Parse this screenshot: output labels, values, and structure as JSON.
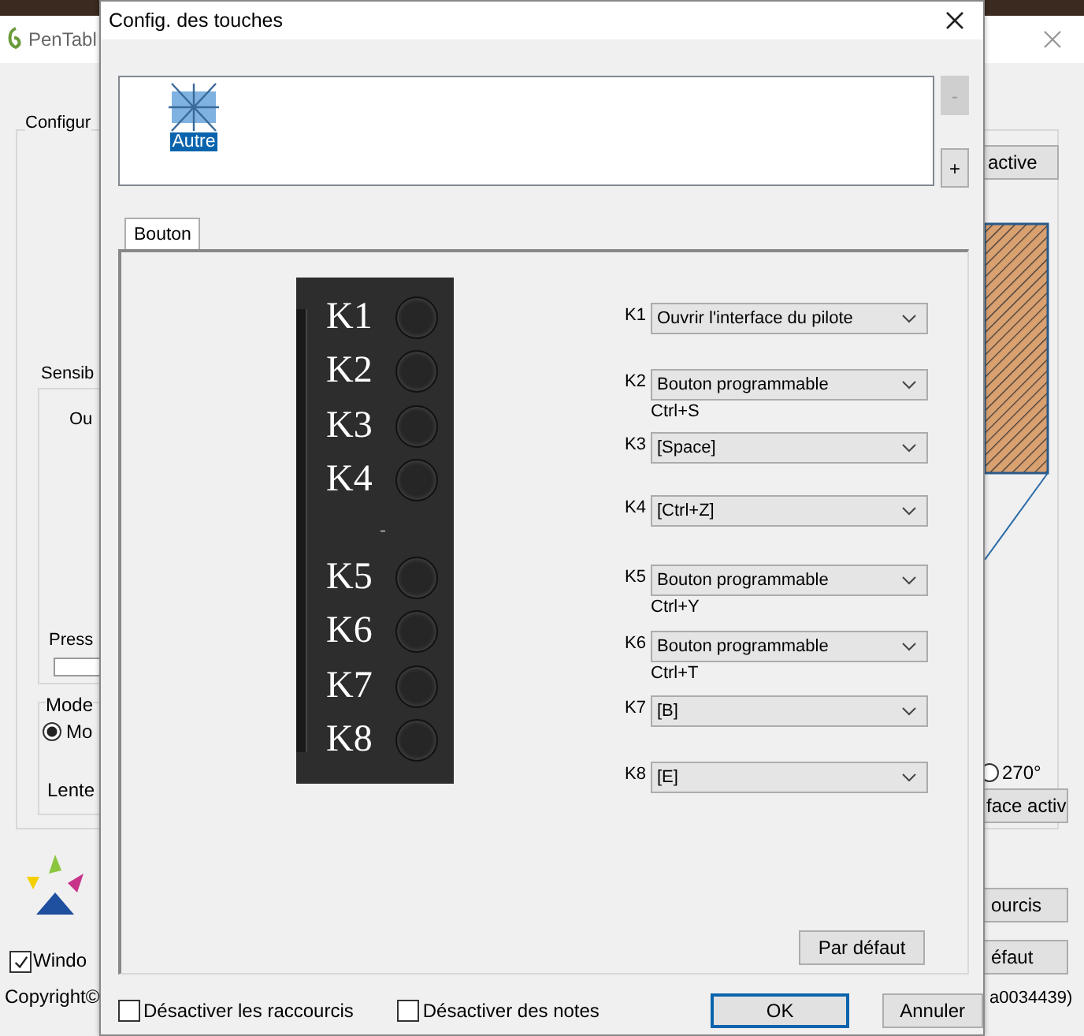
{
  "background_window": {
    "title": "PenTabl",
    "group_title": "Configur",
    "sensitivity_title": "Sensib",
    "output_label": "Ou",
    "pressure_label": "Press",
    "mode_title": "Mode",
    "mode_option": {
      "label": "Mo",
      "selected": true
    },
    "speed_label": "Lente",
    "windows_checkbox": {
      "label": "Windo",
      "checked": true
    },
    "copyright": "Copyright©",
    "active_button": "active",
    "rotation_option": {
      "label": "270°",
      "selected": false
    },
    "interface_button": "face activ",
    "shortcuts_button": "ourcis",
    "default_button": "éfaut",
    "version": "a0034439)"
  },
  "dialog": {
    "title": "Config. des touches",
    "app_list": [
      {
        "label": "Autre",
        "selected": true
      }
    ],
    "remove_button": {
      "label": "-",
      "disabled": true
    },
    "add_button": {
      "label": "+",
      "disabled": false
    },
    "tabs": [
      {
        "label": "Bouton",
        "selected": true
      }
    ],
    "tablet_keys": [
      {
        "kind": "key",
        "label": "K1"
      },
      {
        "kind": "key",
        "label": "K2"
      },
      {
        "kind": "key",
        "label": "K3"
      },
      {
        "kind": "key",
        "label": "K4"
      },
      {
        "kind": "separator",
        "label": "-"
      },
      {
        "kind": "key",
        "label": "K5"
      },
      {
        "kind": "key",
        "label": "K6"
      },
      {
        "kind": "key",
        "label": "K7"
      },
      {
        "kind": "key",
        "label": "K8"
      }
    ],
    "key_assignments": [
      {
        "key": "K1",
        "action": "Ouvrir l'interface du pilote"
      },
      {
        "key": "K2",
        "action": "Bouton programmable",
        "shortcut": "Ctrl+S"
      },
      {
        "key": "K3",
        "action": "[Space]"
      },
      {
        "key": "K4",
        "action": "[Ctrl+Z]"
      },
      {
        "key": "K5",
        "action": "Bouton programmable",
        "shortcut": "Ctrl+Y"
      },
      {
        "key": "K6",
        "action": "Bouton programmable",
        "shortcut": "Ctrl+T"
      },
      {
        "key": "K7",
        "action": "[B]"
      },
      {
        "key": "K8",
        "action": "[E]"
      }
    ],
    "default_button": "Par défaut",
    "options": [
      {
        "label": "Désactiver les raccourcis",
        "checked": false
      },
      {
        "label": "Désactiver des notes",
        "checked": false
      }
    ],
    "ok_button": "OK",
    "cancel_button": "Annuler"
  }
}
